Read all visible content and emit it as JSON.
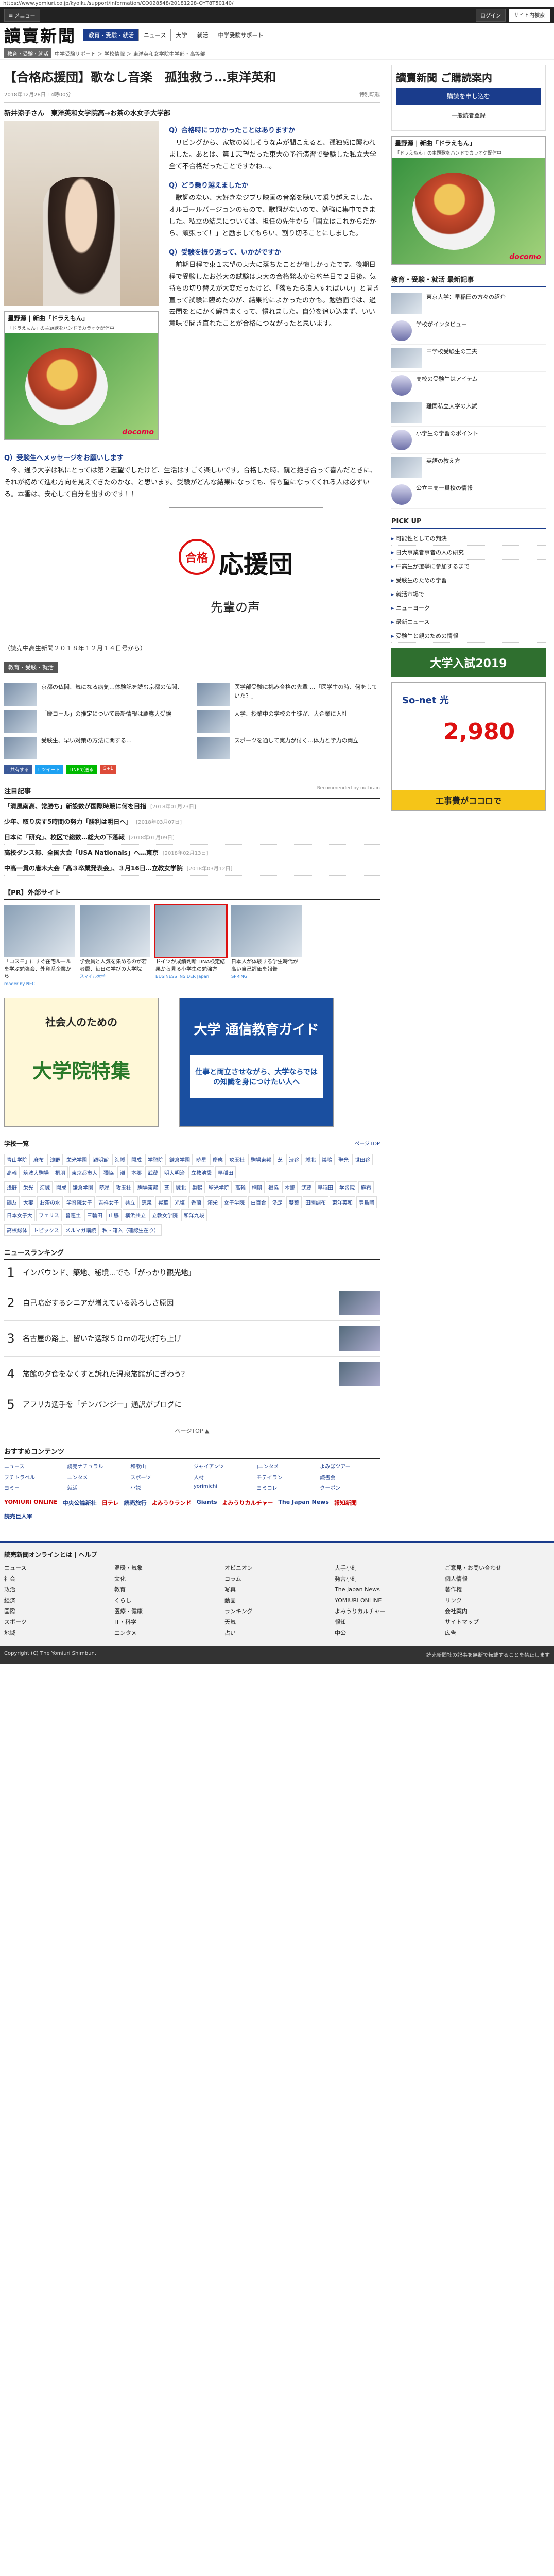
{
  "url": "https://www.yomiuri.co.jp/kyoiku/support/information/CO028548/20181228-OYT8T50140/",
  "topbar": {
    "menu": "≡ メニュー",
    "login": "ログイン",
    "search": "サイト内検索"
  },
  "site": {
    "logo": "讀賣新聞",
    "nav": [
      "教育・受験・就活",
      "ニュース",
      "大学",
      "就活",
      "中学受験サポート"
    ]
  },
  "breadcrumb": "中学受験サポート ＞ 学校情報 ＞ 東洋英和女学院中学部・高等部",
  "category": "教育・受験・就活",
  "article": {
    "title": "【合格応援団】歌なし音楽　孤独救う…東洋英和",
    "date": "2018年12月28日 14時00分",
    "special": "特別転載",
    "caption": "新井涼子さん　東洋英和女学院高→お茶の水女子大学部",
    "q1": "Q）合格時につかかったことはありますか",
    "a1": "リビングから、家族の楽しそうな声が聞こえると、孤独感に襲われました。あとは、第１志望だった東大の予行演習で受験した私立大学全て不合格だったことですかね…。",
    "q2": "Q）どう乗り越えましたか",
    "a2": "歌詞のない、大好きなジブリ映画の音楽を聴いて乗り越えました。オルゴールバージョンのもので、歌詞がないので、勉強に集中できました。私立の結果については、担任の先生から「国立はこれからだから、頑張って！」と励ましてもらい、割り切ることにしました。",
    "q3": "Q）受験を振り返って、いかがですか",
    "a3": "前期日程で東１志望の東大に落ちたことが悔しかったです。後期日程で受験したお茶大の試験は東大の合格発表から約半日で２日後。気持ちの切り替えが大変だったけど、「落ちたら浪人すればいい」と開き直って試験に臨めたのが、結果的によかったのかも。勉強面では、過去問をとにかく解きまくって、慣れました。自分を追い込まず、いい意味で開き直れたことが合格につながったと思います。",
    "q4": "Q）受験生へメッセージをお願いします",
    "a4": "今、通う大学は私にとっては第２志望でしたけど、生活はすごく楽しいです。合格した時、親と抱き合って喜んだときに、それが初めて進む方向を見えてきたのかな、と思います。受験がどんな結果になっても、待ち望になってくれる人は必ずいる。本番は、安心して自分を出すのです！！",
    "source": "（読売中高生新聞２０１８年１２月１４日号から）"
  },
  "ad1": {
    "title": "星野源 | 新曲「ドラえもん」",
    "sub": "「ドラえもん」の主題歌をハンドでカラオケ配信中",
    "brand": "docomo"
  },
  "kouen": {
    "stamp": "合格",
    "title": "応援団",
    "sub": "先輩の声"
  },
  "related": [
    "京都の仏閣、気になる病気…体験記を読む京都の仏閣、",
    "医学部受験に挑み合格の先輩 …「医学生の時、何をしていた？」",
    "「慶コール」の推定について最新情報は慶應大受験",
    "大学、授業中の学校の生徒が、大企業に入社",
    "受験生、早い対策の方法に関する…",
    "スポーツを通して実力が付く…体力と学力の両立"
  ],
  "share": [
    "f 共有する",
    "t ツイート",
    "LINEで送る",
    "G+1"
  ],
  "hot": {
    "title": "注目記事",
    "rec": "Recommended by outbrain",
    "items": [
      {
        "t": "「清風南高、常勝ち」新設数が国際時競に何を目指",
        "d": "[2018年01月23日]"
      },
      {
        "t": "少年、取り戻す5時間の努力「勝利は明日へ」",
        "d": "[2018年03月07日]"
      },
      {
        "t": "日本に「研究」、校区で総数…総大の下落報",
        "d": "[2018年01月09日]"
      },
      {
        "t": "高校ダンス部、全国大会「USA Nationals」へ…東京",
        "d": "[2018年02月13日]"
      },
      {
        "t": "中高一貫の唐木大会「高３卒業発表会」、３月16日…立教女学院",
        "d": "[2018年03月12日]"
      }
    ]
  },
  "pr": {
    "title": "【PR】外部サイト",
    "items": [
      {
        "t": "「コスモ」にすぐ在宅ルールを学ぶ勉強会、外資系企業から",
        "s": "reader by NEC"
      },
      {
        "t": "学会員と人気を集めるのが若者層、毎日の学びの大学院",
        "s": "スマイル大学"
      },
      {
        "t": "ドイツが成績判断 DNA検定結果から見る小学生の勉強方",
        "s": "BUSINESS INSIDER Japan"
      },
      {
        "t": "日本人が体験する学生時代が高い自己評価を報告",
        "s": "SPRING"
      }
    ]
  },
  "banner1": {
    "t": "社会人のための",
    "s": "大学院特集"
  },
  "banner2": {
    "t": "大学 通信教育ガイド",
    "s": "仕事と両立させながら、大学ならではの知識を身につけたい人へ"
  },
  "schools": {
    "title": "学校一覧",
    "more": "ページTOP",
    "co": [
      "青山学院",
      "麻布",
      "浅野",
      "栄光学園",
      "穎明館",
      "海城",
      "開成",
      "学習院",
      "鎌倉学園",
      "暁星",
      "慶應",
      "攻玉社",
      "駒場東邦",
      "芝",
      "渋谷",
      "城北",
      "巣鴨",
      "聖光",
      "世田谷",
      "高輪",
      "筑波大駒場",
      "桐朋",
      "東京都市大",
      "獨協",
      "灘",
      "本郷",
      "武蔵",
      "明大明治",
      "立教池袋",
      "早稲田"
    ],
    "boy": [
      "浅野",
      "栄光",
      "海城",
      "開成",
      "鎌倉学園",
      "暁星",
      "攻玉社",
      "駒場東邦",
      "芝",
      "城北",
      "巣鴨",
      "聖光学院",
      "高輪",
      "桐朋",
      "獨協",
      "本郷",
      "武蔵",
      "早稲田",
      "学習院",
      "麻布"
    ],
    "girl": [
      "鷗友",
      "大妻",
      "お茶の水",
      "学習院女子",
      "吉祥女子",
      "共立",
      "恵泉",
      "晃華",
      "光塩",
      "香蘭",
      "頌栄",
      "女子学院",
      "白百合",
      "洗足",
      "雙葉",
      "田園調布",
      "東洋英和",
      "豊島岡",
      "日本女子大",
      "フェリス",
      "普連土",
      "三輪田",
      "山脇",
      "横浜共立",
      "立教女学院",
      "和洋九段"
    ],
    "other": [
      "高校総体",
      "トピックス",
      "メルマガ購読",
      "私・箱入（確認生在り）"
    ]
  },
  "ranking": {
    "title": "ニュースランキング",
    "items": [
      "インバウンド、築地、秘境…でも「がっかり観光地」",
      "自己暗密するシニアが増えている恐ろしさ原因",
      "名古屋の路上、留いた選球５０ｍの花火打ち上げ",
      "旅館の夕食をなくすと訴れた温泉旅館がにぎわう？",
      "アフリカ選手を「チンパンジー」通訳がブログに"
    ]
  },
  "pagetop": "ページTOP ▲",
  "recommend": {
    "title": "おすすめコンテンツ",
    "items": [
      "ニュース",
      "読売ナチュラル",
      "和歌山",
      "ジャイアンツ",
      "Jエンタメ",
      "よみぽツアー",
      "プチトラベル",
      "エンタメ",
      "スポーツ",
      "人材",
      "モテイラン",
      "読書会",
      "ヨミー",
      "就活",
      "小説",
      "yorimichi",
      "ヨミコレ",
      "クーポン"
    ]
  },
  "affiliates": [
    "YOMIURI ONLINE",
    "中央公論新社",
    "日テレ",
    "読売旅行",
    "よみうりランド",
    "Giants",
    "よみうりカルチャー",
    "The Japan News",
    "報知新聞",
    "読売巨人軍"
  ],
  "sidebar": {
    "brand": "讀賣新聞 ご購読案内",
    "guide": "購読を申し込む",
    "btn": "一般読者登録",
    "newstitle": "教育・受験・就活 最新記事",
    "news": [
      "東京大学：早稲田の方々の紹介",
      "学校がインタビュー",
      "中学校受験生の工夫",
      "高校の受験生はアイテム",
      "難関私立大学の入試",
      "小学生の学習のポイント",
      "英語の教え方",
      "公立中高一貫校の情報"
    ],
    "pickup": "PICK UP",
    "picks": [
      "可能性としての判決",
      "日大事業者事者の人の研究",
      "中高生が選挙に参加するまで",
      "受験生のための学習",
      "就活市場で",
      "ニューヨーク",
      "最新ニュース",
      "受験生と親のための情報"
    ],
    "sonet": {
      "logo": "So-net 光",
      "price": "2,980",
      "foot": "工事費がココロで"
    },
    "nyushi": "大学入試2019"
  },
  "footer": {
    "title": "読売新聞オンラインとは | ヘルプ",
    "cols": [
      [
        "ニュース",
        "社会",
        "政治",
        "経済",
        "国際",
        "スポーツ",
        "地域"
      ],
      [
        "温暖・気象",
        "文化",
        "教育",
        "くらし",
        "医療・健康",
        "IT・科学",
        "エンタメ"
      ],
      [
        "オピニオン",
        "コラム",
        "写真",
        "動画",
        "ランキング",
        "天気",
        "占い"
      ],
      [
        "大手小町",
        "発言小町",
        "The Japan News",
        "YOMIURI ONLINE",
        "よみうりカルチャー",
        "報知",
        "中公"
      ],
      [
        "ご意見・お問い合わせ",
        "個人情報",
        "著作権",
        "リンク",
        "会社案内",
        "サイトマップ",
        "広告"
      ]
    ]
  },
  "copy": "Copyright (C) The Yomiuri Shimbun.",
  "copy2": "読売新聞社の記事を無断で転載することを禁止します"
}
